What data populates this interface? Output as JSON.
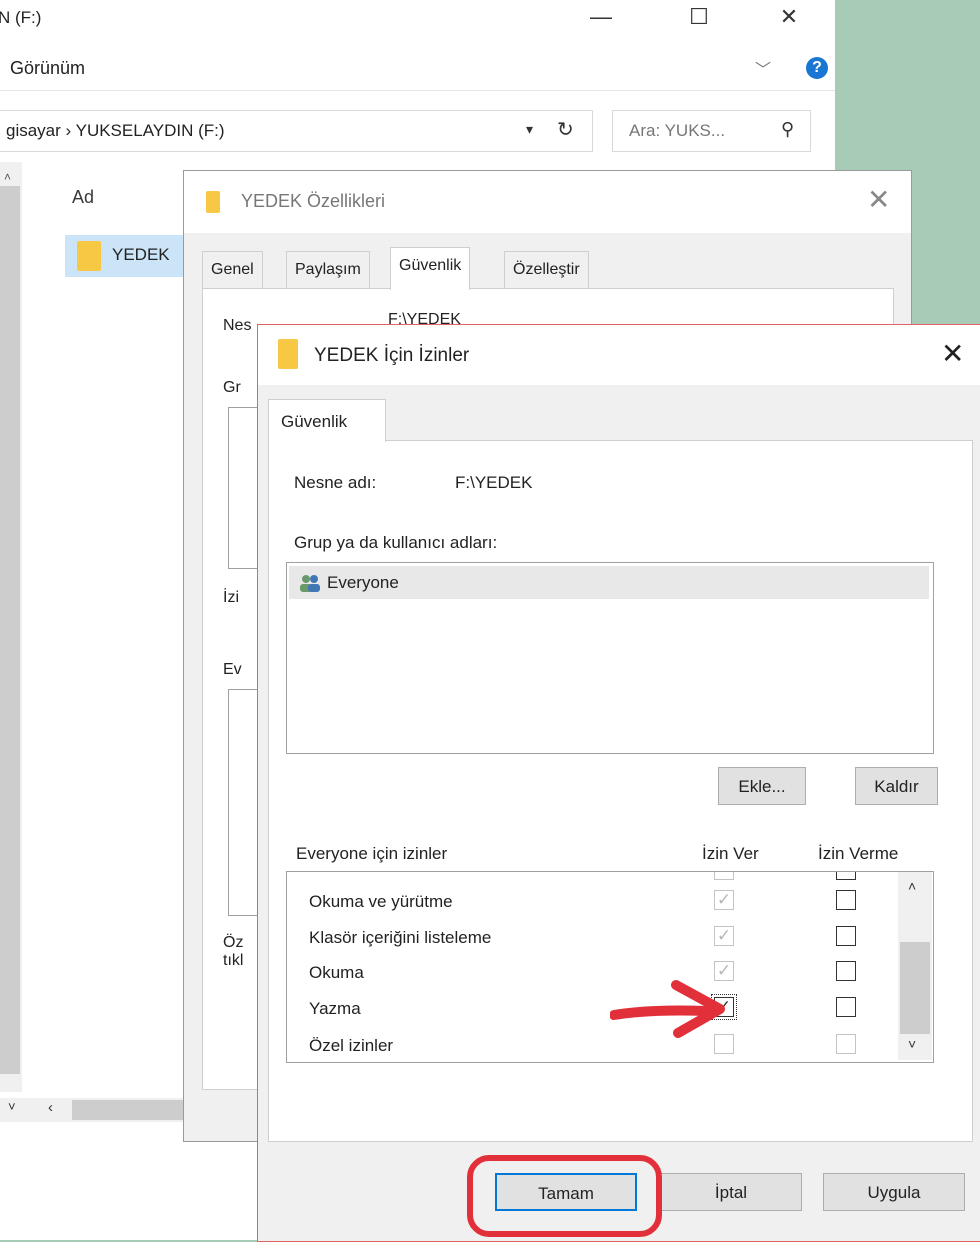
{
  "explorer": {
    "title": "N (F:)",
    "ribbon_view_tab": "Görünüm",
    "address_path": "gisayar  ›  YUKSELAYDIN (F:)",
    "search_placeholder": "Ara: YUKS...",
    "column_name": "Ad",
    "folder_name": "YEDEK"
  },
  "properties_dialog": {
    "title": "YEDEK Özellikleri",
    "tabs": [
      "Genel",
      "Paylaşım",
      "Güvenlik",
      "Özelleştir"
    ],
    "selected_tab": "Güvenlik",
    "partial": {
      "nesne": "Nes",
      "nesne_val": "F:\\YEDEK",
      "gr": "Gr",
      "izin": "İzi",
      "ev": "Ev",
      "oz": "Öz",
      "tikl": "tıkl"
    }
  },
  "permissions_dialog": {
    "title": "YEDEK İçin İzinler",
    "tab": "Güvenlik",
    "object_label": "Nesne adı:",
    "object_value": "F:\\YEDEK",
    "group_label": "Grup ya da kullanıcı adları:",
    "users": [
      "Everyone"
    ],
    "add_button": "Ekle...",
    "remove_button": "Kaldır",
    "perm_header": "Everyone için izinler",
    "allow_header": "İzin Ver",
    "deny_header": "İzin Verme",
    "permissions": [
      {
        "name": "Okuma ve yürütme",
        "allow": true,
        "allow_disabled": true,
        "deny": false,
        "deny_disabled": false
      },
      {
        "name": "Klasör içeriğini listeleme",
        "allow": true,
        "allow_disabled": true,
        "deny": false,
        "deny_disabled": false
      },
      {
        "name": "Okuma",
        "allow": true,
        "allow_disabled": true,
        "deny": false,
        "deny_disabled": false
      },
      {
        "name": "Yazma",
        "allow": true,
        "allow_disabled": false,
        "deny": false,
        "deny_disabled": false
      },
      {
        "name": "Özel izinler",
        "allow": false,
        "allow_disabled": true,
        "deny": false,
        "deny_disabled": true
      }
    ],
    "ok_button": "Tamam",
    "cancel_button": "İptal",
    "apply_button": "Uygula"
  },
  "colors": {
    "annotation": "#e1303a",
    "selection": "#cce4f7",
    "focus_border": "#0078d7"
  },
  "icons": [
    "minimize-icon",
    "maximize-icon",
    "close-icon",
    "help-icon",
    "refresh-icon",
    "search-icon",
    "folder-icon",
    "users-icon",
    "red-arrow-annotation"
  ]
}
